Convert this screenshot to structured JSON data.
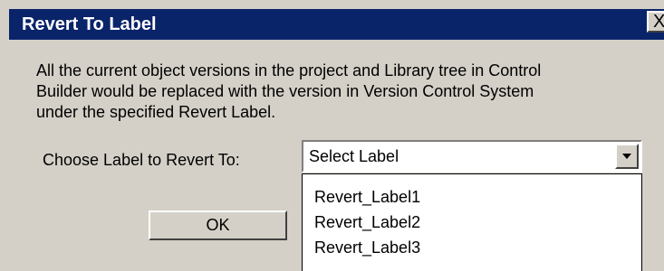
{
  "window": {
    "title": "Revert To Label",
    "close_glyph": "X",
    "titlebar_color": "#0a246a",
    "dialog_bg_color": "#d4d0c8"
  },
  "description": {
    "lines": [
      "All the current object versions in the project and Library tree in Control",
      "Builder would be replaced with the version in Version Control System",
      "under the specified Revert Label."
    ]
  },
  "label_selector": {
    "label": "Choose Label to Revert To:",
    "selected_value": "Select Label",
    "arrow_icon": "chevron-down-icon",
    "options": [
      "Revert_Label1",
      "Revert_Label2",
      "Revert_Label3"
    ]
  },
  "buttons": {
    "ok_label": "OK"
  }
}
